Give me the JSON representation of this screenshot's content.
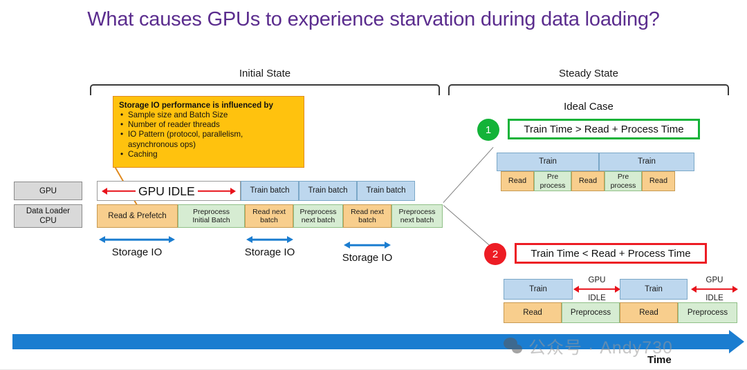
{
  "slide": {
    "title": "What causes GPUs to experience starvation during data loading?",
    "title_color": "#5b2d8e"
  },
  "sections": {
    "initial": {
      "label": "Initial State"
    },
    "steady": {
      "label": "Steady State"
    }
  },
  "callout": {
    "heading": "Storage IO performance is influenced by",
    "bullets": [
      "Sample size and Batch Size",
      "Number of reader threads",
      "IO Pattern (protocol, parallelism,",
      "asynchronous ops)",
      "Caching"
    ],
    "bg_color": "#FFC20E",
    "border_color": "#E08A1E"
  },
  "left_diagram": {
    "row_labels": [
      {
        "line1": "GPU",
        "line2": ""
      },
      {
        "line1": "Data Loader",
        "line2": "CPU"
      }
    ],
    "gpu_row": {
      "idle_label": "GPU IDLE",
      "cells": [
        {
          "label": "Train batch",
          "type": "blue"
        },
        {
          "label": "Train batch",
          "type": "blue"
        },
        {
          "label": "Train batch",
          "type": "blue"
        }
      ]
    },
    "cpu_row": {
      "cells": [
        {
          "label": "Read & Prefetch",
          "label2": "",
          "type": "orange"
        },
        {
          "label": "Preprocess",
          "label2": "Initial Batch",
          "type": "green"
        },
        {
          "label": "Read next",
          "label2": "batch",
          "type": "orange"
        },
        {
          "label": "Preprocess",
          "label2": "next batch",
          "type": "green"
        },
        {
          "label": "Read next",
          "label2": "batch",
          "type": "orange"
        },
        {
          "label": "Preprocess",
          "label2": "next batch",
          "type": "green"
        }
      ]
    },
    "storage_io_labels": [
      "Storage IO",
      "Storage IO",
      "Storage IO"
    ]
  },
  "right_diagram": {
    "case_heading": "Ideal Case",
    "case1": {
      "number": "1",
      "badge_color": "#13B338",
      "banner": "Train Time > Read + Process Time",
      "gpu_cells": [
        {
          "label": "Train"
        },
        {
          "label": "Train"
        }
      ],
      "cpu_cells": [
        {
          "label": "Read",
          "label2": "",
          "type": "orange"
        },
        {
          "label": "Pre",
          "label2": "process",
          "type": "green"
        },
        {
          "label": "Read",
          "label2": "",
          "type": "orange"
        },
        {
          "label": "Pre",
          "label2": "process",
          "type": "green"
        },
        {
          "label": "Read",
          "label2": "",
          "type": "orange"
        }
      ]
    },
    "case2": {
      "number": "2",
      "badge_color": "#ED1C24",
      "banner": "Train Time < Read + Process Time",
      "gpu_cells": [
        {
          "label": "Train",
          "type": "blue"
        },
        {
          "label": "GPU",
          "label2": "IDLE",
          "type": "idle"
        },
        {
          "label": "Train",
          "type": "blue"
        },
        {
          "label": "GPU",
          "label2": "IDLE",
          "type": "idle"
        }
      ],
      "cpu_cells": [
        {
          "label": "Read",
          "type": "orange"
        },
        {
          "label": "Preprocess",
          "type": "green"
        },
        {
          "label": "Read",
          "type": "orange"
        },
        {
          "label": "Preprocess",
          "type": "green"
        }
      ]
    }
  },
  "timeline": {
    "label": "Time",
    "color": "#1B7DD0"
  },
  "watermark": {
    "text": "公众号 · Andy730"
  }
}
